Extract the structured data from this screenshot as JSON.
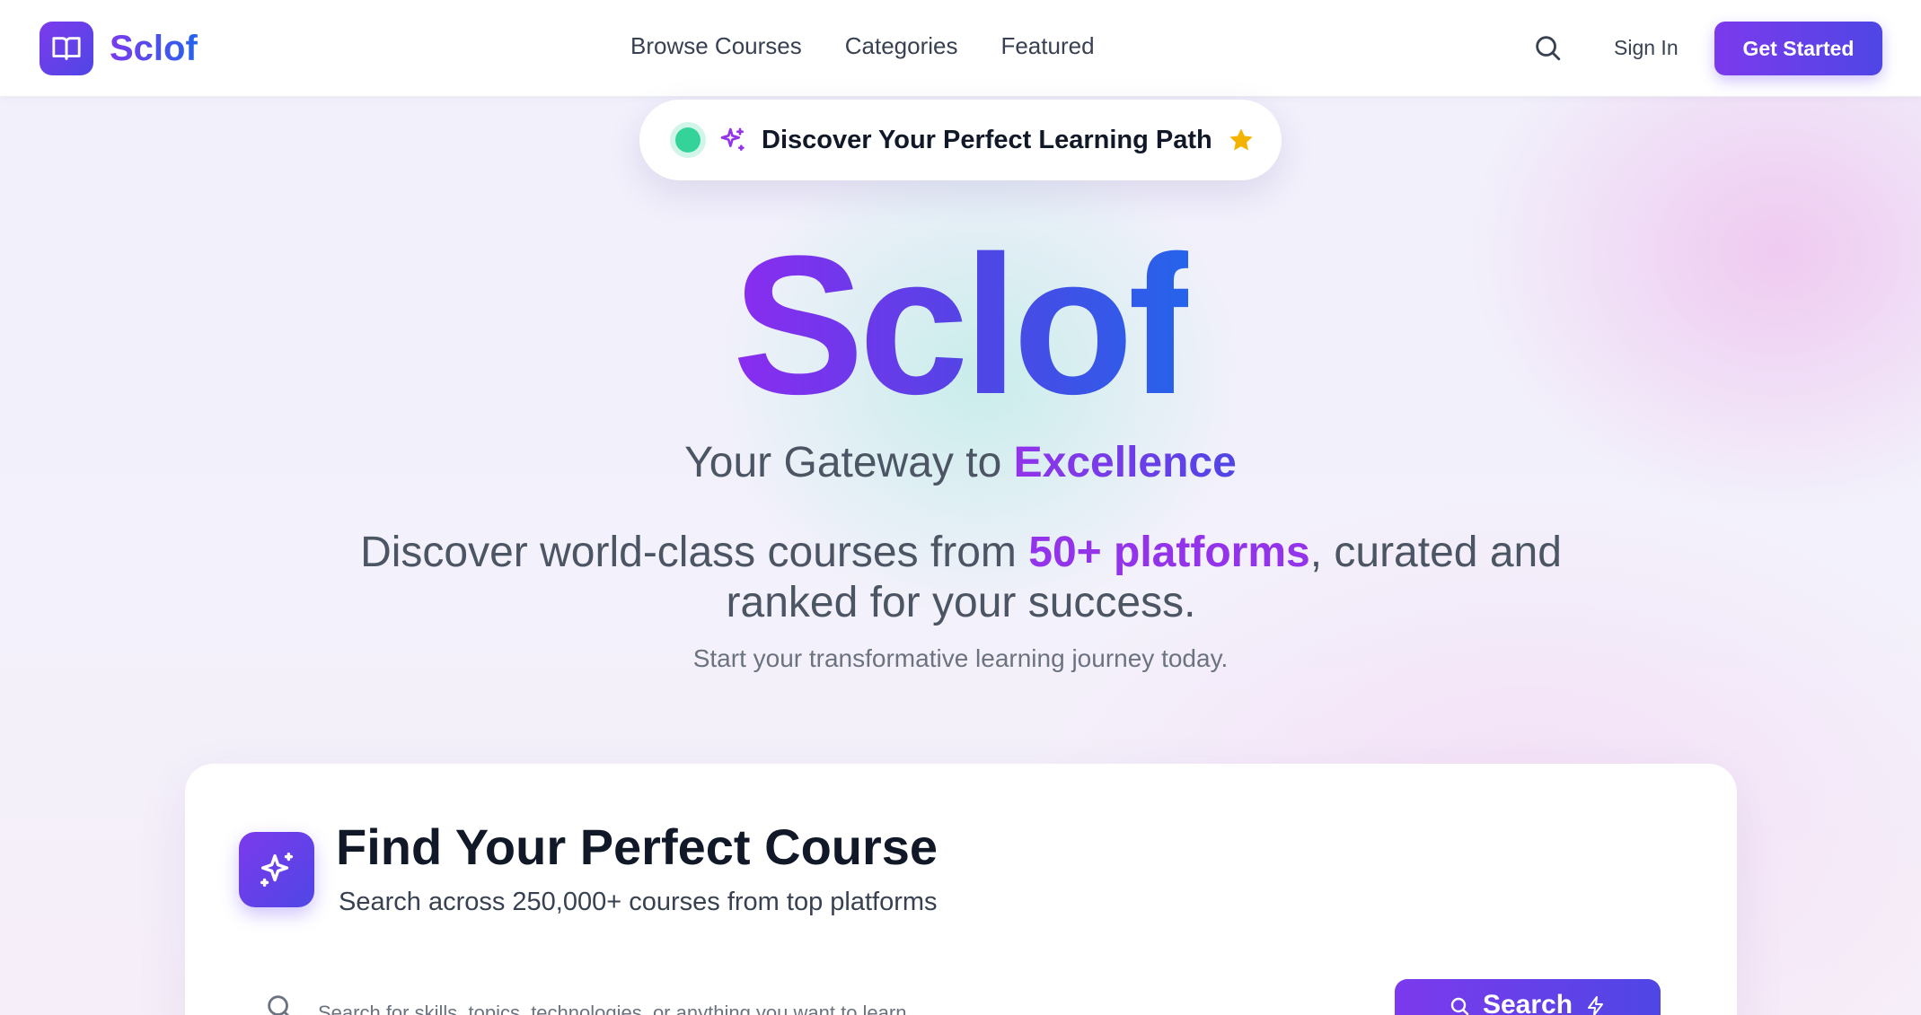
{
  "nav": {
    "brand": "Sclof",
    "links": [
      "Browse Courses",
      "Categories",
      "Featured"
    ],
    "sign_in": "Sign In",
    "get_started": "Get Started",
    "icons": {
      "logo": "book-open-icon",
      "search": "search-icon"
    }
  },
  "pill": {
    "text": "Discover Your Perfect Learning Path",
    "icons": [
      "status-dot",
      "sparkle-icon",
      "star-icon"
    ]
  },
  "hero": {
    "title": "Sclof",
    "tagline_prefix": "Your Gateway to ",
    "tagline_accent": "Excellence",
    "desc_prefix": "Discover world-class courses from ",
    "desc_accent": "50+ platforms",
    "desc_suffix": ", curated and ranked for your success.",
    "subdesc": "Start your transformative learning journey today."
  },
  "search_card": {
    "title": "Find Your Perfect Course",
    "subtitle": "Search across 250,000+ courses from top platforms",
    "placeholder": "Search for skills, topics, technologies, or anything you want to learn...",
    "button_label": "Search"
  },
  "colors": {
    "primary_purple": "#7c3aed",
    "primary_indigo": "#4f46e5",
    "accent_blue": "#2563eb",
    "status_green": "#34d399",
    "star_yellow": "#f5b301"
  }
}
